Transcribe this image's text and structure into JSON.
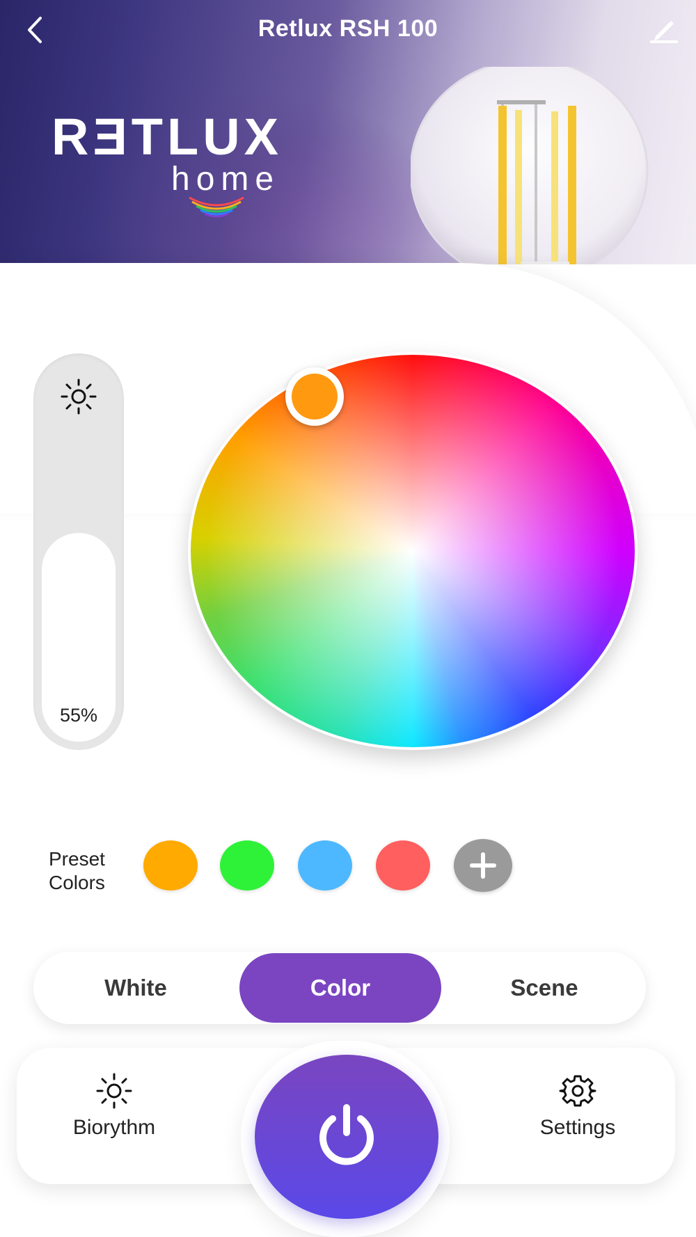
{
  "header": {
    "title": "Retlux RSH 100",
    "back_icon": "chevron-left-icon",
    "edit_icon": "pencil-icon"
  },
  "logo": {
    "word": "RƎTLUX",
    "sub": "home"
  },
  "brightness": {
    "icon": "sun-icon",
    "value_label": "55%",
    "level": 0.55
  },
  "color_wheel": {
    "selected_color": "#ff9a10"
  },
  "presets": {
    "label_line1": "Preset",
    "label_line2": "Colors",
    "colors": [
      "#ffaa00",
      "#2ef238",
      "#4db8ff",
      "#ff5f5f"
    ],
    "add_icon": "plus-icon"
  },
  "tabs": [
    {
      "label": "White",
      "active": false
    },
    {
      "label": "Color",
      "active": true
    },
    {
      "label": "Scene",
      "active": false
    }
  ],
  "bottom_nav": {
    "biorythm_label": "Biorythm",
    "biorythm_icon": "sun-icon",
    "settings_label": "Settings",
    "settings_icon": "gear-icon",
    "power_icon": "power-icon"
  },
  "colors": {
    "accent": "#7b45c1",
    "power_gradient_top": "#7a46c0",
    "power_gradient_bottom": "#5a48e8"
  }
}
